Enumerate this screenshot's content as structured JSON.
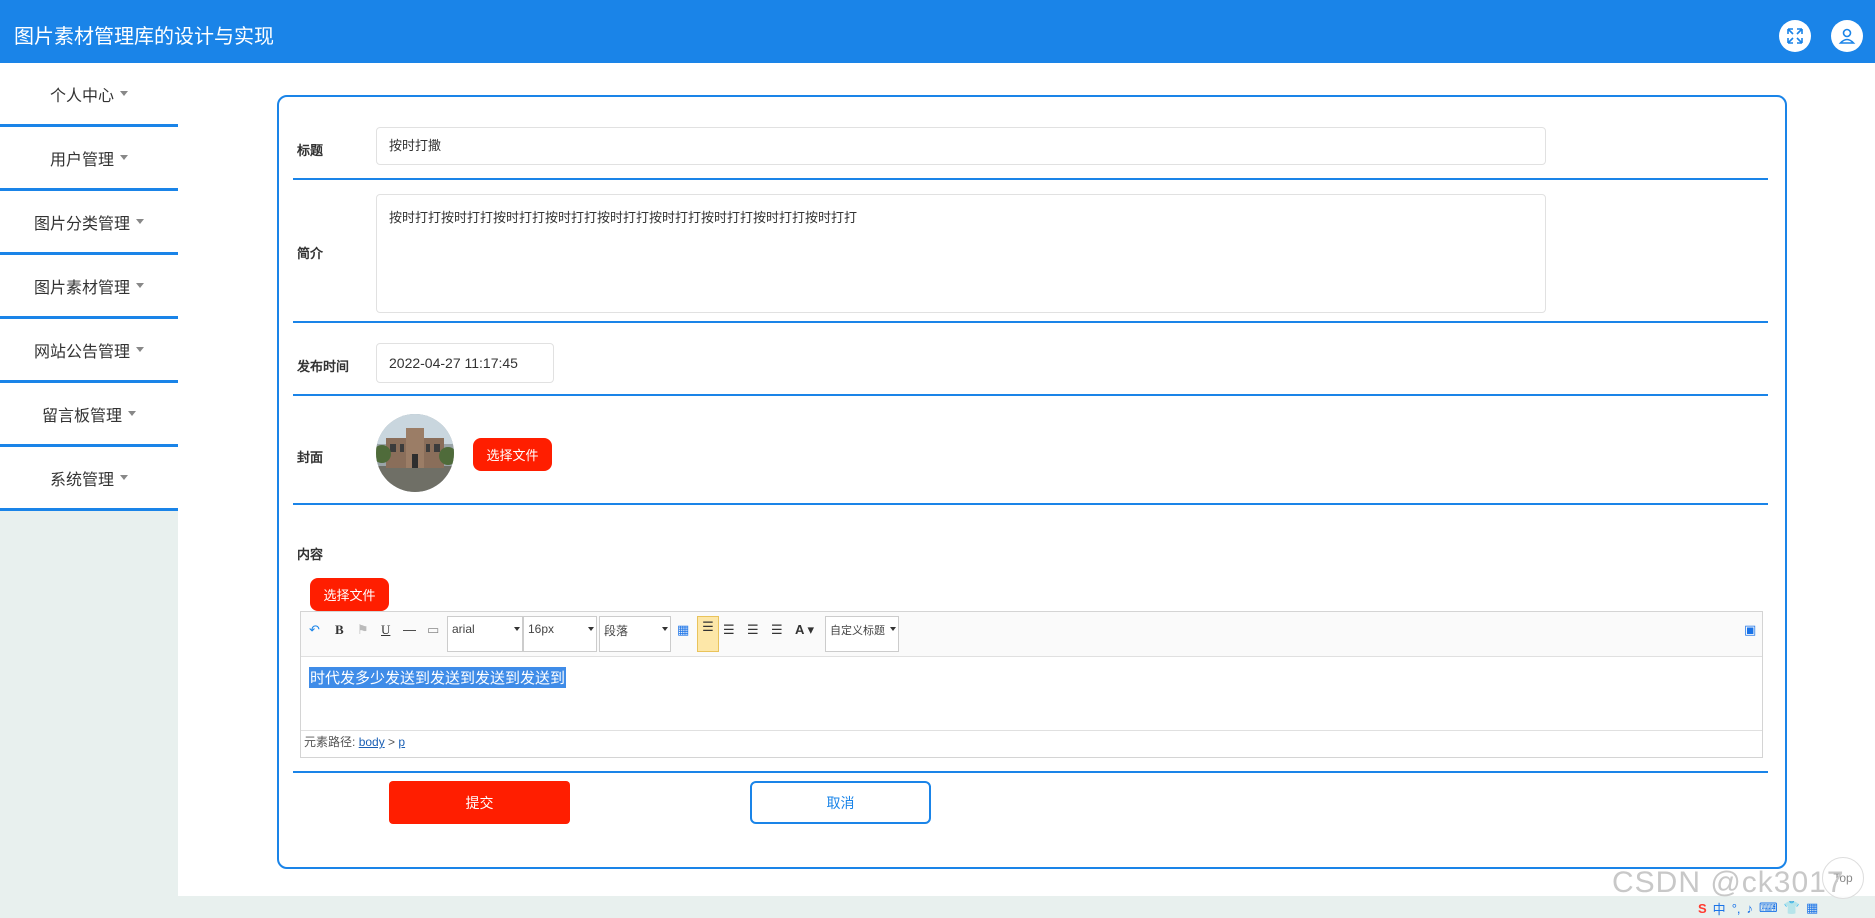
{
  "header": {
    "title": "图片素材管理库的设计与实现"
  },
  "sidebar": {
    "items": [
      {
        "label": "个人中心"
      },
      {
        "label": "用户管理"
      },
      {
        "label": "图片分类管理"
      },
      {
        "label": "图片素材管理"
      },
      {
        "label": "网站公告管理"
      },
      {
        "label": "留言板管理"
      },
      {
        "label": "系统管理"
      }
    ]
  },
  "form": {
    "title_label": "标题",
    "title_value": "按时打撒",
    "intro_label": "简介",
    "intro_value": "按时打打按时打打按时打打按时打打按时打打按时打打按时打打按时打打按时打打",
    "time_label": "发布时间",
    "time_value": "2022-04-27 11:17:45",
    "cover_label": "封面",
    "cover_select_label": "选择文件",
    "content_label": "内容",
    "content_select_label": "选择文件",
    "submit_label": "提交",
    "cancel_label": "取消"
  },
  "editor": {
    "font_family": "arial",
    "font_size": "16px",
    "paragraph": "段落",
    "custom_heading": "自定义标题",
    "selected_text": "时代发多少发送到发送到发送到发送到",
    "path_label": "元素路径:",
    "path_body": "body",
    "path_sep": " > ",
    "path_p": "p"
  },
  "watermark": "CSDN @ck3017",
  "back_to_top": "Top",
  "tray": {
    "ime": "中"
  },
  "colors": {
    "primary": "#1a84e8",
    "danger": "#ff1e00"
  }
}
